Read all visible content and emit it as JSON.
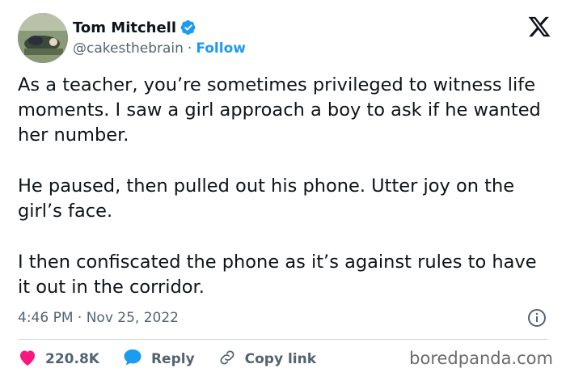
{
  "author": {
    "name": "Tom Mitchell",
    "handle": "@cakesthebrain",
    "separator": "·",
    "follow_label": "Follow",
    "verified": true
  },
  "tweet": {
    "paragraphs": [
      "As a teacher, you’re sometimes privileged to witness life moments. I saw a girl approach a boy to ask if he wanted her number.",
      "He paused, then pulled out his phone. Utter joy on the girl’s face.",
      "I then confiscated the phone as it’s against rules to have it out in the corridor."
    ],
    "timestamp": "4:46 PM · Nov 25, 2022"
  },
  "actions": {
    "like_count": "220.8K",
    "reply_label": "Reply",
    "copy_link_label": "Copy link"
  },
  "icons": {
    "like": "heart-icon",
    "reply": "speech-bubble-icon",
    "copy_link": "link-icon",
    "info": "info-icon",
    "platform": "x-logo-icon",
    "verified": "verified-badge-icon"
  },
  "colors": {
    "accent": "#1d9bf0",
    "like": "#f91880",
    "secondary_text": "#536471",
    "primary_text": "#0f1419"
  },
  "watermark": "boredpanda.com"
}
